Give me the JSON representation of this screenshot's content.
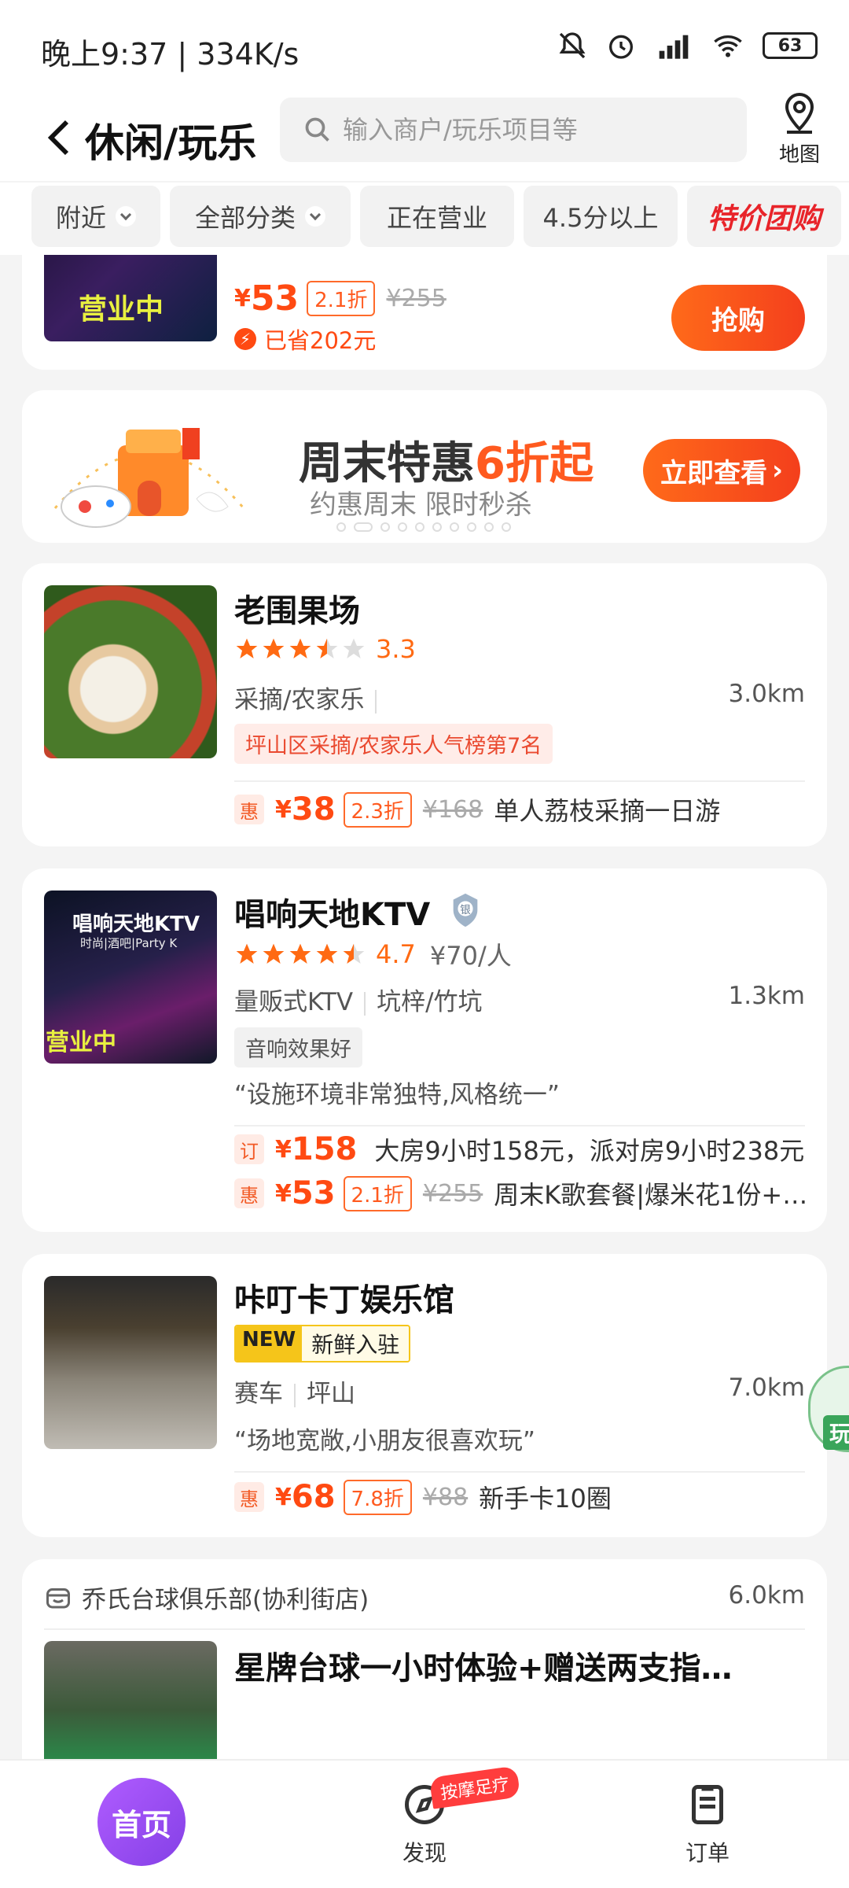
{
  "status": {
    "time": "晚上9:37 | 334K/s",
    "battery": "63"
  },
  "header": {
    "title": "休闲/玩乐",
    "search_placeholder": "输入商户/玩乐项目等",
    "map_label": "地图"
  },
  "filters": {
    "nearby": "附近",
    "all_categories": "全部分类",
    "open_now": "正在营业",
    "rating": "4.5分以上",
    "special": "特价团购"
  },
  "top_card": {
    "thumb_text": "营业中",
    "price": "53",
    "discount": "2.1折",
    "original": "¥255",
    "saved": "已省202元",
    "buy_label": "抢购"
  },
  "banner": {
    "title_prefix": "周末特惠",
    "title_highlight": "6折起",
    "subtitle": "约惠周末 限时秒杀",
    "button_label": "立即查看"
  },
  "shops": [
    {
      "name": "老围果场",
      "score": "3.3",
      "rating": 3.5,
      "category": "采摘/农家乐",
      "distance": "3.0km",
      "rank_tag": "坪山区采摘/农家乐人气榜第7名",
      "deals": [
        {
          "badge": "惠",
          "price": "38",
          "discount": "2.3折",
          "original": "¥168",
          "desc": "单人荔枝采摘一日游"
        }
      ]
    },
    {
      "name": "唱响天地KTV",
      "score": "4.7",
      "rating": 4.5,
      "per_person": "¥70/人",
      "category": "量贩式KTV",
      "area": "坑梓/竹坑",
      "distance": "1.3km",
      "thumb_title": "唱响天地KTV",
      "thumb_sub": "时尚|酒吧|Party K",
      "thumb_open": "营业中",
      "tag": "音响效果好",
      "quote": "“设施环境非常独特,风格统一”",
      "deals": [
        {
          "badge": "订",
          "price": "158",
          "desc": "大房9小时158元，派对房9小时238元"
        },
        {
          "badge": "惠",
          "price": "53",
          "discount": "2.1折",
          "original": "¥255",
          "desc": "周末K歌套餐|爆米花1份+…"
        }
      ]
    },
    {
      "name": "咔叮卡丁娱乐馆",
      "new_badge": "NEW",
      "new_text": "新鲜入驻",
      "category": "赛车",
      "area": "坪山",
      "distance": "7.0km",
      "quote": "“场地宽敞,小朋友很喜欢玩”",
      "deals": [
        {
          "badge": "惠",
          "price": "68",
          "discount": "7.8折",
          "original": "¥88",
          "desc": "新手卡10圈"
        }
      ]
    },
    {
      "shop_line": "乔氏台球俱乐部(协利街店)",
      "distance": "6.0km",
      "name": "星牌台球一小时体验+赠送两支指…"
    }
  ],
  "float_text": "玩",
  "bottom_nav": {
    "home": "首页",
    "discover": "发现",
    "discover_badge": "按摩足疗",
    "orders": "订单"
  }
}
